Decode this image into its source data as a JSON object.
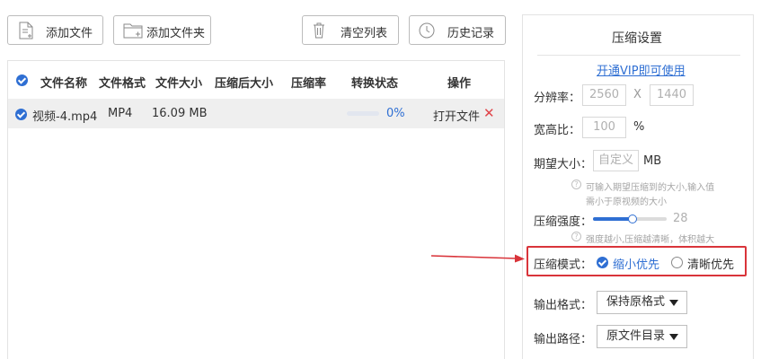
{
  "toolbar": {
    "add_file": "添加文件",
    "add_folder": "添加文件夹",
    "clear_list": "清空列表",
    "history": "历史记录"
  },
  "table": {
    "headers": {
      "name": "文件名称",
      "format": "文件格式",
      "size": "文件大小",
      "compressed_size": "压缩后大小",
      "ratio": "压缩率",
      "status": "转换状态",
      "actions": "操作"
    },
    "rows": [
      {
        "name": "视频-4.mp4",
        "format": "MP4",
        "size": "16.09 MB",
        "compressed_size": "",
        "ratio": "",
        "progress_percent": "0%",
        "progress": 0,
        "open_label": "打开文件",
        "delete_label": "✕"
      }
    ]
  },
  "settings": {
    "title": "压缩设置",
    "vip_link": "开通VIP即可使用",
    "resolution_label": "分辨率：",
    "resolution_width": "2560",
    "resolution_sep": "X",
    "resolution_height": "1440",
    "aspect_label": "宽高比：",
    "aspect_value": "100",
    "aspect_unit": "%",
    "target_size_label": "期望大小：",
    "target_size_placeholder": "自定义",
    "target_size_unit": "MB",
    "target_size_hint_line1": "可输入期望压缩到的大小,输入值",
    "target_size_hint_line2": "需小于原视频的大小",
    "strength_label": "压缩强度：",
    "strength_value": "28",
    "strength_slider_fraction": 0.54,
    "strength_hint": "强度越小,压缩越清晰，体积越大",
    "mode_label": "压缩模式：",
    "mode_options": [
      "缩小优先",
      "清晰优先"
    ],
    "mode_selected": "缩小优先",
    "output_format_label": "输出格式：",
    "output_format_value": "保持原格式",
    "output_path_label": "输出路径：",
    "output_path_value": "原文件目录"
  },
  "colors": {
    "accent_blue": "#2f6fd3",
    "highlight_red": "#d9343a",
    "delete_red": "#e0454a"
  }
}
